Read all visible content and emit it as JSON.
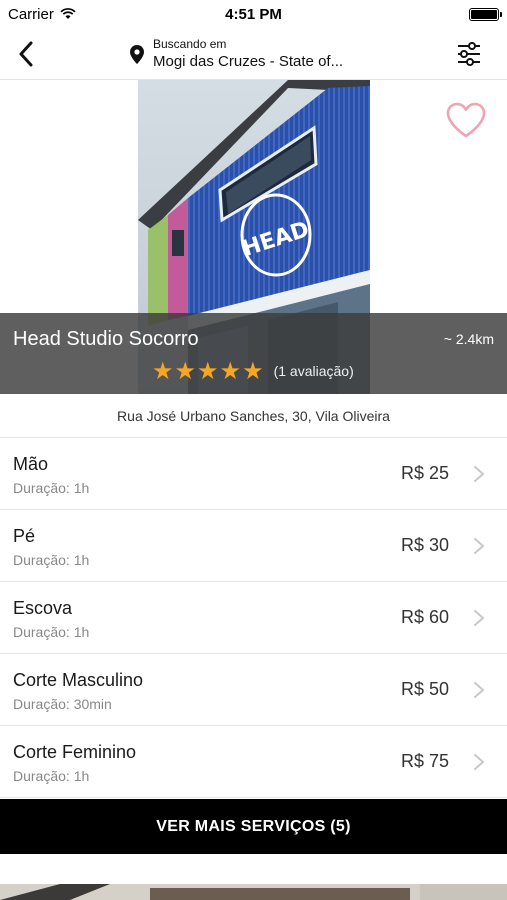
{
  "status_bar": {
    "carrier": "Carrier",
    "time": "4:51 PM"
  },
  "nav": {
    "location_caption": "Buscando em",
    "location_value": "Mogi das Cruzes - State of..."
  },
  "salon": {
    "name": "Head Studio Socorro",
    "distance": "~ 2.4km",
    "rating": 5,
    "reviews": "(1 avaliação)",
    "address": "Rua José Urbano Sanches, 30, Vila Oliveira",
    "favorite_color": "#f0a3b2",
    "star_color": "#f5a623",
    "sign_text": "HEAD"
  },
  "services": [
    {
      "name": "Mão",
      "duration": "Duração: 1h",
      "price": "R$ 25"
    },
    {
      "name": "Pé",
      "duration": "Duração: 1h",
      "price": "R$ 30"
    },
    {
      "name": "Escova",
      "duration": "Duração: 1h",
      "price": "R$ 60"
    },
    {
      "name": "Corte Masculino",
      "duration": "Duração: 30min",
      "price": "R$ 50"
    },
    {
      "name": "Corte Feminino",
      "duration": "Duração: 1h",
      "price": "R$ 75"
    }
  ],
  "more_button": "VER MAIS SERVIÇOS (5)",
  "icons": {
    "wifi": "wifi-icon",
    "battery": "battery-icon",
    "back": "chevron-left-icon",
    "location": "location-pin-icon",
    "filter": "sliders-icon",
    "favorite": "heart-outline-icon",
    "row": "chevron-right-icon"
  }
}
